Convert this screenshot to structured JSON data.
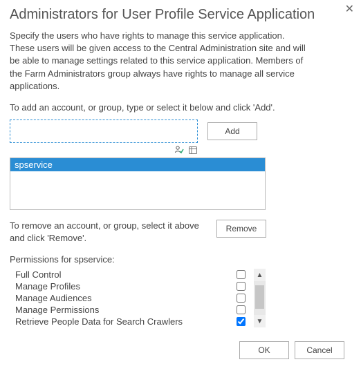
{
  "title": "Administrators for User Profile Service Application",
  "close_glyph": "✕",
  "description": "Specify the users who have rights to manage this service application. These users will be given access to the Central Administration site and will be able to manage settings related to this service application. Members of the Farm Administrators group always have rights to manage all service applications.",
  "add_instruction": "To add an account, or group, type or select it below and click 'Add'.",
  "account_input": {
    "value": ""
  },
  "buttons": {
    "add": "Add",
    "remove": "Remove",
    "ok": "OK",
    "cancel": "Cancel"
  },
  "selected_accounts": [
    {
      "name": "spservice",
      "selected": true
    }
  ],
  "remove_instruction": "To remove an account, or group, select it above and click 'Remove'.",
  "permissions_label": "Permissions for spservice:",
  "permissions": [
    {
      "label": "Full Control",
      "checked": false
    },
    {
      "label": "Manage Profiles",
      "checked": false
    },
    {
      "label": "Manage Audiences",
      "checked": false
    },
    {
      "label": "Manage Permissions",
      "checked": false
    },
    {
      "label": "Retrieve People Data for Search Crawlers",
      "checked": true
    }
  ]
}
